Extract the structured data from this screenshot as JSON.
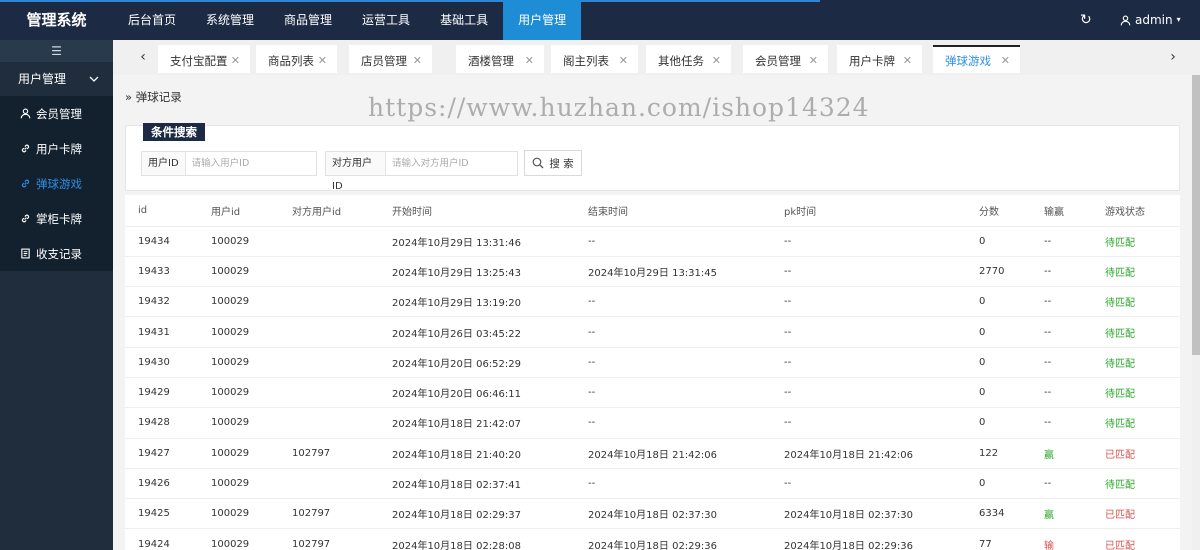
{
  "app": {
    "title": "管理系统"
  },
  "top_nav": [
    "后台首页",
    "系统管理",
    "商品管理",
    "运营工具",
    "基础工具",
    "用户管理"
  ],
  "top_nav_active": 5,
  "user": {
    "name": "admin"
  },
  "sidebar": {
    "collapse_icon": "menu-collapse-icon",
    "group": "用户管理",
    "items": [
      {
        "label": "会员管理",
        "icon": "user-icon"
      },
      {
        "label": "用户卡牌",
        "icon": "link-icon"
      },
      {
        "label": "弹球游戏",
        "icon": "link-icon",
        "active": true
      },
      {
        "label": "掌柜卡牌",
        "icon": "link-icon"
      },
      {
        "label": "收支记录",
        "icon": "ledger-icon"
      }
    ]
  },
  "tabs": [
    "支付宝配置",
    "商品列表",
    "店员管理",
    "酒楼管理",
    "阁主列表",
    "其他任务",
    "会员管理",
    "用户卡牌",
    "弹球游戏"
  ],
  "active_tab": 8,
  "breadcrumb": "弹球记录",
  "watermark": "https://www.huzhan.com/ishop14324",
  "search": {
    "title": "条件搜索",
    "user_id_label": "用户ID",
    "user_id_placeholder": "请输入用户ID",
    "opp_id_label": "对方用户ID",
    "opp_id_placeholder": "请输入对方用户ID",
    "button": "搜 索"
  },
  "table": {
    "columns": [
      "id",
      "用户id",
      "对方用户id",
      "开始时间",
      "结束时间",
      "pk时间",
      "分数",
      "输赢",
      "游戏状态"
    ],
    "rows": [
      [
        "19434",
        "100029",
        "",
        "2024年10月29日 13:31:46",
        "--",
        "--",
        "0",
        "--",
        "待匹配"
      ],
      [
        "19433",
        "100029",
        "",
        "2024年10月29日 13:25:43",
        "2024年10月29日 13:31:45",
        "--",
        "2770",
        "--",
        "待匹配"
      ],
      [
        "19432",
        "100029",
        "",
        "2024年10月29日 13:19:20",
        "--",
        "--",
        "0",
        "--",
        "待匹配"
      ],
      [
        "19431",
        "100029",
        "",
        "2024年10月26日 03:45:22",
        "--",
        "--",
        "0",
        "--",
        "待匹配"
      ],
      [
        "19430",
        "100029",
        "",
        "2024年10月20日 06:52:29",
        "--",
        "--",
        "0",
        "--",
        "待匹配"
      ],
      [
        "19429",
        "100029",
        "",
        "2024年10月20日 06:46:11",
        "--",
        "--",
        "0",
        "--",
        "待匹配"
      ],
      [
        "19428",
        "100029",
        "",
        "2024年10月18日 21:42:07",
        "--",
        "--",
        "0",
        "--",
        "待匹配"
      ],
      [
        "19427",
        "100029",
        "102797",
        "2024年10月18日 21:40:20",
        "2024年10月18日 21:42:06",
        "2024年10月18日 21:42:06",
        "122",
        "赢",
        "已匹配"
      ],
      [
        "19426",
        "100029",
        "",
        "2024年10月18日 02:37:41",
        "--",
        "--",
        "0",
        "--",
        "待匹配"
      ],
      [
        "19425",
        "100029",
        "102797",
        "2024年10月18日 02:29:37",
        "2024年10月18日 02:37:30",
        "2024年10月18日 02:37:30",
        "6334",
        "赢",
        "已匹配"
      ],
      [
        "19424",
        "100029",
        "102797",
        "2024年10月18日 02:28:08",
        "2024年10月18日 02:29:36",
        "2024年10月18日 02:29:36",
        "77",
        "输",
        "已匹配"
      ]
    ]
  },
  "colors": {
    "topbar": "#1c2a43",
    "accent": "#1f8cd6",
    "sidebar": "#1f2d3d",
    "waiting": "#2aa82a",
    "matched": "#d9534f"
  }
}
